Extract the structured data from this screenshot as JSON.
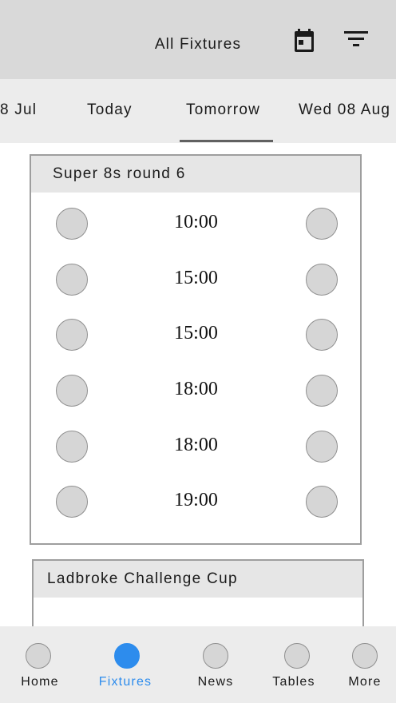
{
  "header": {
    "title": "All Fixtures",
    "calendar_icon": "calendar-icon",
    "filter_icon": "filter-icon"
  },
  "date_tabs": [
    {
      "label": "8 Jul",
      "selected": false
    },
    {
      "label": "Today",
      "selected": false
    },
    {
      "label": "Tomorrow",
      "selected": true
    },
    {
      "label": "Wed 08 Aug",
      "selected": false
    }
  ],
  "competitions": [
    {
      "name": "Super 8s round 6",
      "fixtures": [
        {
          "time": "10:00"
        },
        {
          "time": "15:00"
        },
        {
          "time": "15:00"
        },
        {
          "time": "18:00"
        },
        {
          "time": "18:00"
        },
        {
          "time": "19:00"
        }
      ]
    },
    {
      "name": "Ladbroke Challenge Cup",
      "fixtures": []
    }
  ],
  "bottom_nav": [
    {
      "label": "Home",
      "active": false
    },
    {
      "label": "Fixtures",
      "active": true
    },
    {
      "label": "News",
      "active": false
    },
    {
      "label": "Tables",
      "active": false
    },
    {
      "label": "More",
      "active": false
    }
  ],
  "colors": {
    "accent": "#2d8ced",
    "header_bg": "#d9d9d9",
    "tab_bar_bg": "#ececec",
    "card_header_bg": "#e6e6e6"
  }
}
